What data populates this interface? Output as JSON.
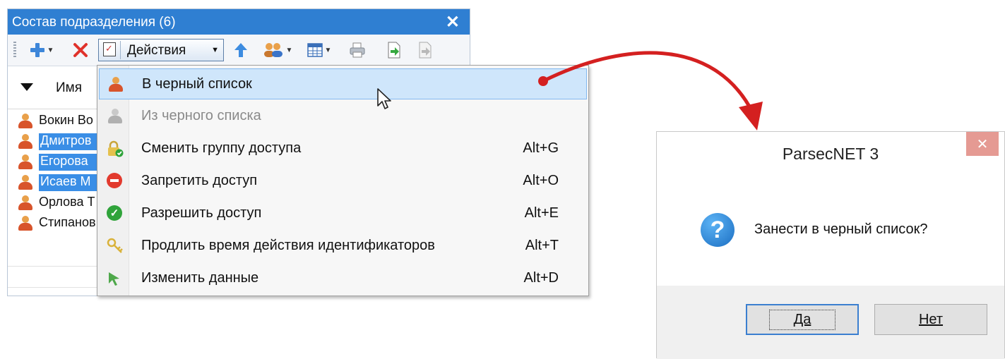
{
  "window": {
    "title": "Состав подразделения (6)",
    "close_glyph": "✕",
    "toolbar": {
      "actions_label": "Действия",
      "icons": [
        "add-icon",
        "delete-icon",
        "actions-icon",
        "up-arrow-icon",
        "users-icon",
        "table-icon",
        "print-icon",
        "export-icon",
        "import-icon"
      ]
    },
    "grid": {
      "column_header": "Имя",
      "rows": [
        {
          "name": "Вокин Во",
          "selected": false
        },
        {
          "name": "Дмитров",
          "selected": true
        },
        {
          "name": "Егорова",
          "selected": true
        },
        {
          "name": "Исаев М",
          "selected": true
        },
        {
          "name": "Орлова Т",
          "selected": false
        },
        {
          "name": "Стипанов",
          "selected": false
        }
      ]
    }
  },
  "menu": {
    "items": [
      {
        "label": "В черный список",
        "shortcut": "",
        "icon": "user-blacklist-icon",
        "highlighted": true,
        "disabled": false
      },
      {
        "label": "Из черного списка",
        "shortcut": "",
        "icon": "user-grey-icon",
        "highlighted": false,
        "disabled": true
      },
      {
        "label": "Сменить группу доступа",
        "shortcut": "Alt+G",
        "icon": "lock-group-icon",
        "highlighted": false,
        "disabled": false
      },
      {
        "label": "Запретить доступ",
        "shortcut": "Alt+O",
        "icon": "deny-icon",
        "highlighted": false,
        "disabled": false
      },
      {
        "label": "Разрешить доступ",
        "shortcut": "Alt+E",
        "icon": "allow-icon",
        "highlighted": false,
        "disabled": false
      },
      {
        "label": "Продлить время действия идентификаторов",
        "shortcut": "Alt+T",
        "icon": "keys-icon",
        "highlighted": false,
        "disabled": false
      },
      {
        "label": "Изменить данные",
        "shortcut": "Alt+D",
        "icon": "edit-data-icon",
        "highlighted": false,
        "disabled": false
      }
    ]
  },
  "dialog": {
    "title": "ParsecNET 3",
    "message": "Занести в черный список?",
    "yes_label": "Да",
    "no_label": "Нет",
    "close_glyph": "✕"
  },
  "colors": {
    "titlebar": "#2f7fd2",
    "selection": "#3a8ee6",
    "menu_highlight": "#cfe6fb",
    "arrow": "#d42020"
  }
}
